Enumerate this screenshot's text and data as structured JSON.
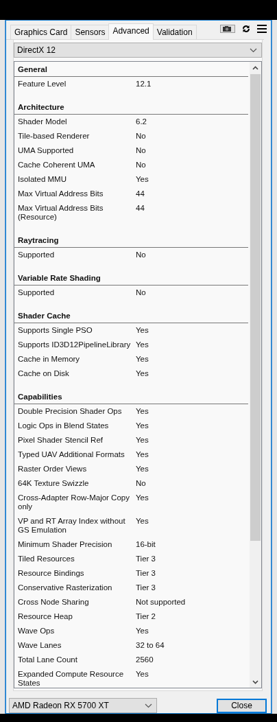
{
  "tabs": [
    {
      "label": "Graphics Card",
      "selected": false
    },
    {
      "label": "Sensors",
      "selected": false
    },
    {
      "label": "Advanced",
      "selected": true
    },
    {
      "label": "Validation",
      "selected": false
    }
  ],
  "api_select": {
    "value": "DirectX 12"
  },
  "sections": [
    {
      "title": "General",
      "rows": [
        {
          "label": "Feature Level",
          "value": "12.1"
        }
      ]
    },
    {
      "title": "Architecture",
      "rows": [
        {
          "label": "Shader Model",
          "value": "6.2"
        },
        {
          "label": "Tile-based Renderer",
          "value": "No"
        },
        {
          "label": "UMA Supported",
          "value": "No"
        },
        {
          "label": "Cache Coherent UMA",
          "value": "No"
        },
        {
          "label": "Isolated MMU",
          "value": "Yes"
        },
        {
          "label": "Max Virtual Address Bits",
          "value": "44"
        },
        {
          "label": "Max Virtual Address Bits (Resource)",
          "value": "44"
        }
      ]
    },
    {
      "title": "Raytracing",
      "rows": [
        {
          "label": "Supported",
          "value": "No"
        }
      ]
    },
    {
      "title": "Variable Rate Shading",
      "rows": [
        {
          "label": "Supported",
          "value": "No"
        }
      ]
    },
    {
      "title": "Shader Cache",
      "rows": [
        {
          "label": "Supports Single PSO",
          "value": "Yes"
        },
        {
          "label": "Supports ID3D12PipelineLibrary",
          "value": "Yes"
        },
        {
          "label": "Cache in Memory",
          "value": "Yes"
        },
        {
          "label": "Cache on Disk",
          "value": "Yes"
        }
      ]
    },
    {
      "title": "Capabilities",
      "rows": [
        {
          "label": "Double Precision Shader Ops",
          "value": "Yes"
        },
        {
          "label": "Logic Ops in Blend States",
          "value": "Yes"
        },
        {
          "label": "Pixel Shader Stencil Ref",
          "value": "Yes"
        },
        {
          "label": "Typed UAV Additional Formats",
          "value": "Yes"
        },
        {
          "label": "Raster Order Views",
          "value": "Yes"
        },
        {
          "label": "64K Texture Swizzle",
          "value": "No"
        },
        {
          "label": "Cross-Adapter Row-Major Copy only",
          "value": "Yes"
        },
        {
          "label": "VP and RT Array Index without GS Emulation",
          "value": "Yes"
        },
        {
          "label": "Minimum Shader Precision",
          "value": "16-bit"
        },
        {
          "label": "Tiled Resources",
          "value": "Tier 3"
        },
        {
          "label": "Resource Bindings",
          "value": "Tier 3"
        },
        {
          "label": "Conservative Rasterization",
          "value": "Tier 3"
        },
        {
          "label": "Cross Node Sharing",
          "value": "Not supported"
        },
        {
          "label": "Resource Heap",
          "value": "Tier 2"
        },
        {
          "label": "Wave Ops",
          "value": "Yes"
        },
        {
          "label": "Wave Lanes",
          "value": "32 to 64"
        },
        {
          "label": "Total Lane Count",
          "value": "2560"
        },
        {
          "label": "Expanded Compute Resource States",
          "value": "Yes"
        }
      ]
    }
  ],
  "gpu_select": {
    "value": "AMD Radeon RX 5700 XT"
  },
  "close_button": {
    "label": "Close"
  }
}
